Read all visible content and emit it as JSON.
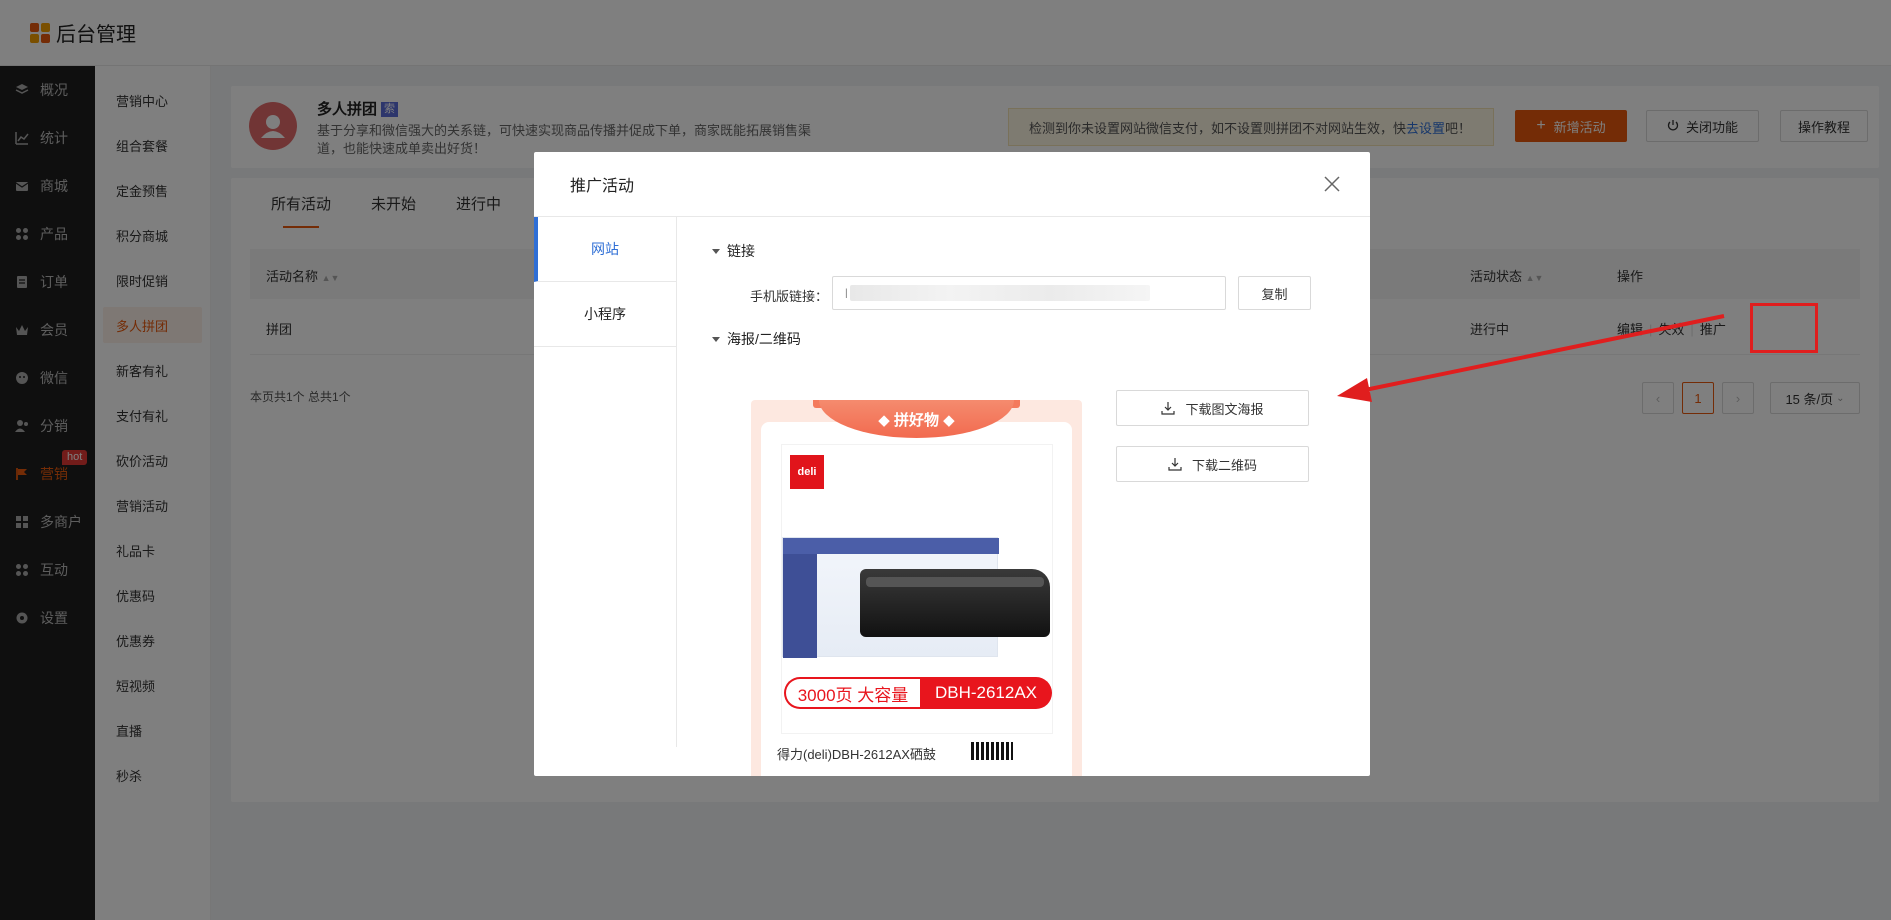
{
  "app": {
    "title": "后台管理"
  },
  "primary_nav": [
    {
      "label": "概况",
      "icon": "layers-icon"
    },
    {
      "label": "统计",
      "icon": "chart-icon"
    },
    {
      "label": "商城",
      "icon": "mail-icon"
    },
    {
      "label": "产品",
      "icon": "grid-icon"
    },
    {
      "label": "订单",
      "icon": "clipboard-icon"
    },
    {
      "label": "会员",
      "icon": "crown-icon"
    },
    {
      "label": "微信",
      "icon": "wechat-icon"
    },
    {
      "label": "分销",
      "icon": "users-icon"
    },
    {
      "label": "营销",
      "icon": "flag-icon",
      "badge": "hot",
      "active": true
    },
    {
      "label": "多商户",
      "icon": "store-icon"
    },
    {
      "label": "互动",
      "icon": "grid-icon"
    },
    {
      "label": "设置",
      "icon": "gear-icon"
    }
  ],
  "secondary_nav": [
    "营销中心",
    "组合套餐",
    "定金预售",
    "积分商城",
    "限时促销",
    "多人拼团",
    "新客有礼",
    "支付有礼",
    "砍价活动",
    "营销活动",
    "礼品卡",
    "优惠码",
    "优惠券",
    "短视频",
    "直播",
    "秒杀"
  ],
  "header": {
    "title": "多人拼团",
    "title_badge": "索",
    "desc": "基于分享和微信强大的关系链，可快速实现商品传播并促成下单，商家既能拓展销售渠道，也能快速成单卖出好货！",
    "warn_text": "检测到你未设置网站微信支付，如不设置则拼团不对网站生效，快",
    "warn_link": "去设置",
    "warn_end": "吧！",
    "btn_add": "新增活动",
    "btn_close": "关闭功能",
    "btn_tutorial": "操作教程"
  },
  "tabs": [
    "所有活动",
    "未开始",
    "进行中"
  ],
  "table": {
    "headers": {
      "name": "活动名称",
      "status": "活动状态",
      "ops": "操作"
    },
    "rows": [
      {
        "name": "拼团",
        "status": "进行中",
        "ops": [
          "编辑",
          "失效",
          "推广"
        ]
      }
    ],
    "page_info": "本页共1个 总共1个",
    "page_current": "1",
    "page_size": "15 条/页",
    "prev": "‹",
    "next": "›"
  },
  "modal": {
    "title": "推广活动",
    "tabs": [
      "网站",
      "小程序"
    ],
    "section_link": "链接",
    "field_label": "手机版链接：",
    "field_value_prefix": "l",
    "btn_copy": "复制",
    "section_poster": "海报/二维码",
    "btn_download_poster": "下载图文海报",
    "btn_download_qr": "下载二维码",
    "poster": {
      "ribbon": "◆ 拼好物 ◆",
      "logo": "deli",
      "capacity": "3000页 大容量",
      "model": "DBH-2612AX",
      "caption": "得力(deli)DBH-2612AX硒鼓"
    }
  },
  "colors": {
    "accent": "#e8590c",
    "link": "#2f6fd6",
    "annotation": "#e01e1e"
  }
}
